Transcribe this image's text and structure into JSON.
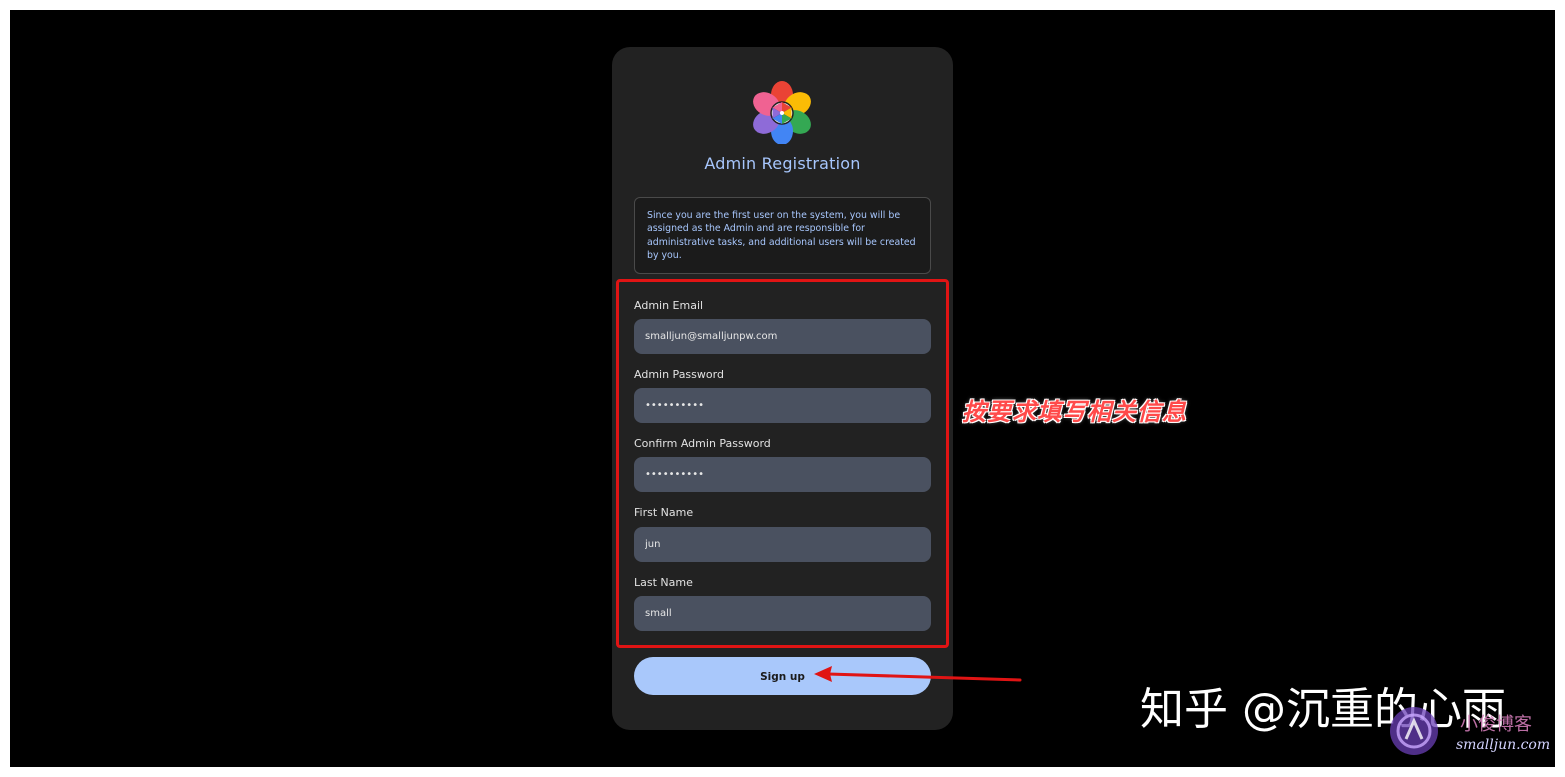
{
  "form": {
    "title": "Admin Registration",
    "notice": "Since you are the first user on the system, you will be assigned as the Admin and are responsible for administrative tasks, and additional users will be created by you.",
    "fields": [
      {
        "label": "Admin Email",
        "value": "smalljun@smalljunpw.com"
      },
      {
        "label": "Admin Password",
        "value": "••••••••••"
      },
      {
        "label": "Confirm Admin Password",
        "value": "••••••••••"
      },
      {
        "label": "First Name",
        "value": "jun"
      },
      {
        "label": "Last Name",
        "value": "small"
      }
    ],
    "submit_label": "Sign up"
  },
  "annotations": {
    "note": "按要求填写相关信息"
  },
  "watermarks": {
    "zhihu": "知乎 @沉重的心雨",
    "blog_name": "小俊博客",
    "blog_url": "smalljun.com"
  },
  "colors": {
    "accent": "#a7c6fc",
    "highlight": "#e01414",
    "input_bg": "#4a5160",
    "card_bg": "#222222"
  },
  "icons": {
    "logo": "flower-logo-icon",
    "arrow": "red-arrow"
  }
}
